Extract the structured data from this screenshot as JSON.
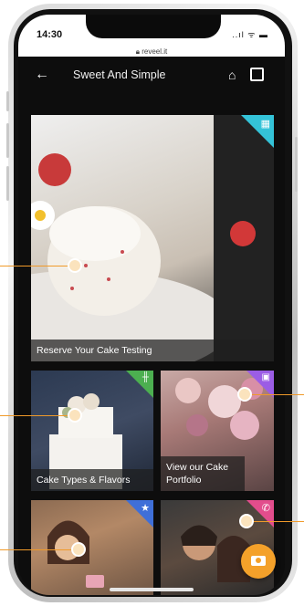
{
  "status_bar": {
    "time": "14:30",
    "url": "reveel.it",
    "indicators": "..ıl ᯤ ▬"
  },
  "app_bar": {
    "title": "Sweet And Simple",
    "back_icon": "arrow-left-icon",
    "home_icon": "home-icon",
    "gallery_icon": "gallery-icon"
  },
  "tiles": {
    "reserve": {
      "caption": "Reserve Your Cake Testing",
      "badge_color": "#34c3d8",
      "badge_icon": "calendar-icon"
    },
    "cake_types": {
      "caption": "Cake Types & Flavors",
      "badge_color": "#4caf50",
      "badge_icon": "fork-knife-icon"
    },
    "portfolio": {
      "caption": "View our Cake Portfolio",
      "badge_color": "#9b5de5",
      "badge_icon": "image-icon"
    },
    "reviews": {
      "badge_color": "#3f6fd8",
      "badge_icon": "star-icon"
    },
    "contact": {
      "badge_color": "#e24d8c",
      "badge_icon": "phone-icon"
    }
  },
  "fab": {
    "icon": "camera-icon",
    "color": "#f4a12a"
  },
  "accent": "#f09a2a"
}
